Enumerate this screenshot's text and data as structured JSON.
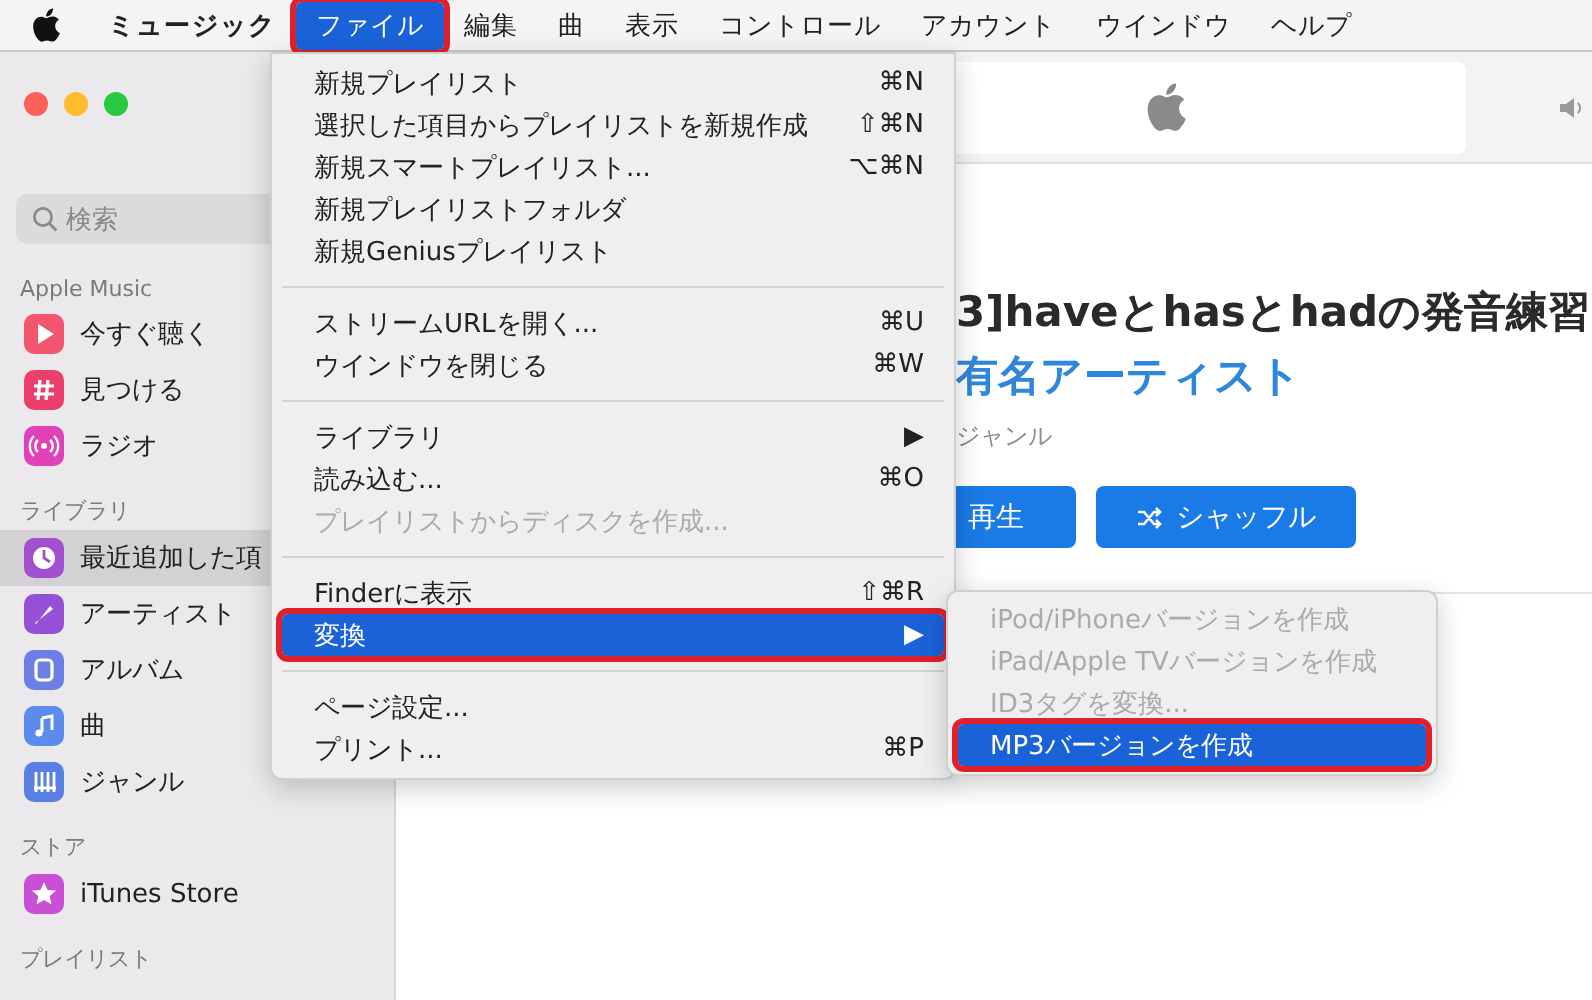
{
  "menubar": {
    "app_name": "ミュージック",
    "menus": [
      {
        "label": "ファイル",
        "selected": true,
        "annotated": true
      },
      {
        "label": "編集",
        "selected": false,
        "annotated": false
      },
      {
        "label": "曲",
        "selected": false,
        "annotated": false
      },
      {
        "label": "表示",
        "selected": false,
        "annotated": false
      },
      {
        "label": "コントロール",
        "selected": false,
        "annotated": false
      },
      {
        "label": "アカウント",
        "selected": false,
        "annotated": false
      },
      {
        "label": "ウインドウ",
        "selected": false,
        "annotated": false
      },
      {
        "label": "ヘルプ",
        "selected": false,
        "annotated": false
      }
    ]
  },
  "sidebar": {
    "search": {
      "placeholder": "検索"
    },
    "sections": [
      {
        "title": "Apple Music",
        "items": [
          {
            "label": "今すぐ聴く",
            "kind": "play",
            "color": "#f2566f",
            "selected": false
          },
          {
            "label": "見つける",
            "kind": "browse",
            "color": "#ea3f6a",
            "selected": false
          },
          {
            "label": "ラジオ",
            "kind": "radio",
            "color": "#e040b8",
            "selected": false
          }
        ]
      },
      {
        "title": "ライブラリ",
        "items": [
          {
            "label": "最近追加した項",
            "kind": "recent",
            "color": "#a24fd0",
            "selected": true
          },
          {
            "label": "アーティスト",
            "kind": "artist",
            "color": "#9650d8",
            "selected": false
          },
          {
            "label": "アルバム",
            "kind": "album",
            "color": "#6c7fe6",
            "selected": false
          },
          {
            "label": "曲",
            "kind": "song",
            "color": "#5b8bec",
            "selected": false
          },
          {
            "label": "ジャンル",
            "kind": "genre",
            "color": "#5a7fe2",
            "selected": false
          }
        ]
      },
      {
        "title": "ストア",
        "items": [
          {
            "label": "iTunes Store",
            "kind": "store",
            "color": "#c94fd6",
            "selected": false
          }
        ]
      },
      {
        "title": "プレイリスト"
      }
    ]
  },
  "content": {
    "title": "3]haveとhasとhadの発音練習",
    "artist": "有名アーティスト",
    "genre": "ジャンル",
    "buttons": [
      {
        "label": "再生",
        "kind": "play"
      },
      {
        "label": "シャッフル",
        "kind": "shuffle"
      }
    ]
  },
  "file_menu": {
    "groups": [
      [
        {
          "label": "新規プレイリスト",
          "shortcut": "⌘N",
          "disabled": false,
          "selected": false,
          "annotated": false
        },
        {
          "label": "選択した項目からプレイリストを新規作成",
          "shortcut": "⇧⌘N",
          "disabled": false,
          "selected": false,
          "annotated": false
        },
        {
          "label": "新規スマートプレイリスト...",
          "shortcut": "⌥⌘N",
          "disabled": false,
          "selected": false,
          "annotated": false
        },
        {
          "label": "新規プレイリストフォルダ",
          "disabled": false,
          "selected": false,
          "annotated": false
        },
        {
          "label": "新規Geniusプレイリスト",
          "disabled": false,
          "selected": false,
          "annotated": false
        }
      ],
      [
        {
          "label": "ストリームURLを開く...",
          "shortcut": "⌘U",
          "disabled": false,
          "selected": false,
          "annotated": false
        },
        {
          "label": "ウインドウを閉じる",
          "shortcut": "⌘W",
          "disabled": false,
          "selected": false,
          "annotated": false
        }
      ],
      [
        {
          "label": "ライブラリ",
          "shortcut": "▶",
          "disabled": false,
          "selected": false,
          "annotated": false
        },
        {
          "label": "読み込む...",
          "shortcut": "⌘O",
          "disabled": false,
          "selected": false,
          "annotated": false
        },
        {
          "label": "プレイリストからディスクを作成...",
          "disabled": true,
          "selected": false,
          "annotated": false
        }
      ],
      [
        {
          "label": "Finderに表示",
          "shortcut": "⇧⌘R",
          "disabled": false,
          "selected": false,
          "annotated": false
        },
        {
          "label": "変換",
          "shortcut": "▶",
          "disabled": false,
          "selected": true,
          "annotated": true
        }
      ],
      [
        {
          "label": "ページ設定...",
          "disabled": false,
          "selected": false,
          "annotated": false
        },
        {
          "label": "プリント...",
          "shortcut": "⌘P",
          "disabled": false,
          "selected": false,
          "annotated": false
        }
      ]
    ]
  },
  "convert_submenu": {
    "items": [
      {
        "label": "iPod/iPhoneバージョンを作成",
        "disabled": true,
        "selected": false,
        "annotated": false
      },
      {
        "label": "iPad/Apple TVバージョンを作成",
        "disabled": true,
        "selected": false,
        "annotated": false
      },
      {
        "label": "ID3タグを変換...",
        "disabled": true,
        "selected": false,
        "annotated": false
      },
      {
        "label": "MP3バージョンを作成",
        "disabled": false,
        "selected": true,
        "annotated": true
      }
    ]
  }
}
